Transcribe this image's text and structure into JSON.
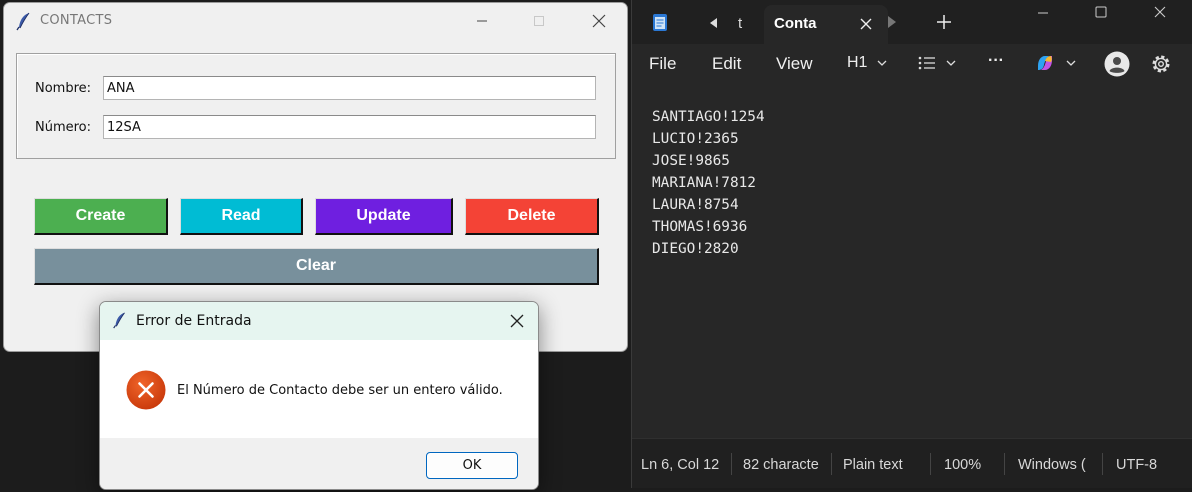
{
  "tk_window": {
    "title": "CONTACTS",
    "fields": {
      "name_label": "Nombre:",
      "name_value": "ANA",
      "number_label": "Número:",
      "number_value": "12SA"
    },
    "buttons": [
      {
        "label": "Create",
        "color": "#4caf50"
      },
      {
        "label": "Read",
        "color": "#00bcd4"
      },
      {
        "label": "Update",
        "color": "#6f1fe0"
      },
      {
        "label": "Delete",
        "color": "#f44336"
      },
      {
        "label": "Clear",
        "color": "#78909c"
      }
    ]
  },
  "error_dialog": {
    "title": "Error de Entrada",
    "message": "El Número de Contacto debe ser un entero válido.",
    "ok_label": "OK",
    "icon": "error-icon",
    "icon_color": "#e0400c"
  },
  "notepad": {
    "tabs": {
      "previous_label": "t",
      "active_label": "Conta"
    },
    "menu": {
      "file": "File",
      "edit": "Edit",
      "view": "View",
      "heading": "H1",
      "more": "···"
    },
    "lines": [
      "SANTIAGO!1254",
      "LUCIO!2365",
      "JOSE!9865",
      "MARIANA!7812",
      "LAURA!8754",
      "THOMAS!6936",
      "DIEGO!2820"
    ],
    "status": {
      "position": "Ln 6, Col 12",
      "characters": "82 characte",
      "format": "Plain text",
      "zoom": "100%",
      "line_ending": "Windows (",
      "encoding": "UTF-8"
    }
  }
}
